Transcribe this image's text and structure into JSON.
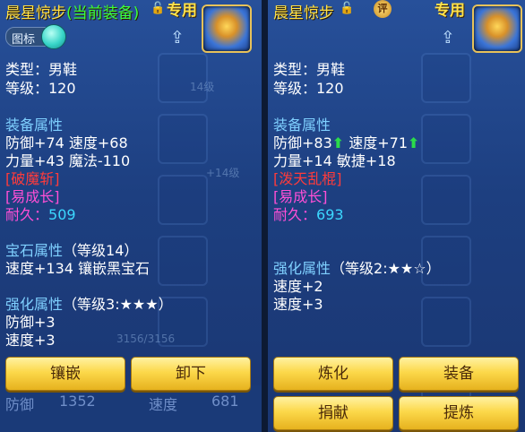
{
  "left": {
    "title": "晨星惊步",
    "current_tag": "(当前装备)",
    "exclusive": "专用",
    "badge_label": "图标",
    "type_line": "类型：男鞋",
    "level_line": "等级：120",
    "attr_header": "装备属性",
    "attr_line1": "防御+74 速度+68",
    "attr_line2": "力量+43 魔法-110",
    "special1": "[破魔斩]",
    "special2": "[易成长]",
    "durability_label": "耐久：",
    "durability_value": "509",
    "gem_header": "宝石属性",
    "gem_level": "（等级14）",
    "gem_line": "速度+134 镶嵌黑宝石",
    "enh_header": "强化属性",
    "enh_level": "（等级3:★★★）",
    "enh_line1": "防御+3",
    "enh_line2": "速度+3",
    "btn_inlay": "镶嵌",
    "btn_unequip": "卸下",
    "bg_text1": "14级",
    "bg_text2": "+14级",
    "bg_text3": "3156/3156",
    "bg_bottom1": "防御",
    "bg_bottom2": "1352",
    "bg_bottom3": "速度",
    "bg_bottom4": "681"
  },
  "right": {
    "title": "晨星惊步",
    "exclusive": "专用",
    "ping": "评",
    "type_line": "类型：男鞋",
    "level_line": "等级：120",
    "attr_header": "装备属性",
    "attr_line1a": "防御+83",
    "attr_line1b": " 速度+71",
    "attr_line2": "力量+14 敏捷+18",
    "special1": "[泼天乱棍]",
    "special2": "[易成长]",
    "durability_label": "耐久：",
    "durability_value": "693",
    "enh_header": "强化属性",
    "enh_level": "（等级2:★★☆）",
    "enh_line1": "速度+2",
    "enh_line2": "速度+3",
    "btn_refine": "炼化",
    "btn_equip": "装备",
    "btn_donate": "捐献",
    "btn_extract": "提炼"
  }
}
